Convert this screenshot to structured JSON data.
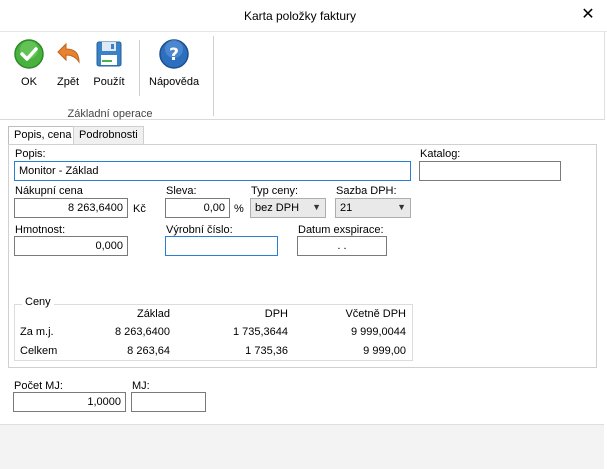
{
  "window": {
    "title": "Karta položky faktury",
    "close_glyph": "✕"
  },
  "ribbon": {
    "buttons": [
      {
        "label": "OK",
        "icon": "check-icon",
        "color": "#3fa535"
      },
      {
        "label": "Zpět",
        "icon": "undo-arrow-icon",
        "color": "#e07a2a"
      },
      {
        "label": "Použít",
        "icon": "save-icon",
        "color": "#3a7fc4"
      },
      {
        "label": "Nápověda",
        "icon": "help-icon",
        "color": "#2a6ab8"
      }
    ],
    "group_label": "Základní operace"
  },
  "tabs": [
    {
      "label": "Popis, cena",
      "active": true
    },
    {
      "label": "Podrobnosti",
      "active": false
    }
  ],
  "form": {
    "popis_label": "Popis:",
    "popis_value": "Monitor - Základ",
    "katalog_label": "Katalog:",
    "katalog_value": "",
    "nakupni_cena_label": "Nákupní cena",
    "nakupni_cena_value": "8 263,6400",
    "currency": "Kč",
    "sleva_label": "Sleva:",
    "sleva_value": "0,00",
    "percent": "%",
    "typ_ceny_label": "Typ ceny:",
    "typ_ceny_value": "bez DPH",
    "sazba_dph_label": "Sazba DPH:",
    "sazba_dph_value": "21",
    "hmotnost_label": "Hmotnost:",
    "hmotnost_value": "0,000",
    "vyrobni_cislo_label": "Výrobní číslo:",
    "vyrobni_cislo_value": "",
    "datum_expirace_label": "Datum exspirace:",
    "datum_expirace_value": ".   ."
  },
  "prices": {
    "title": "Ceny",
    "columns": [
      "Základ",
      "DPH",
      "Včetně DPH"
    ],
    "rows": [
      {
        "label": "Za m.j.",
        "zaklad": "8 263,6400",
        "dph": "1 735,3644",
        "vcetne": "9 999,0044"
      },
      {
        "label": "Celkem",
        "zaklad": "8 263,64",
        "dph": "1 735,36",
        "vcetne": "9 999,00"
      }
    ]
  },
  "bottom": {
    "pocet_mj_label": "Počet MJ:",
    "pocet_mj_value": "1,0000",
    "mj_label": "MJ:",
    "mj_value": ""
  }
}
